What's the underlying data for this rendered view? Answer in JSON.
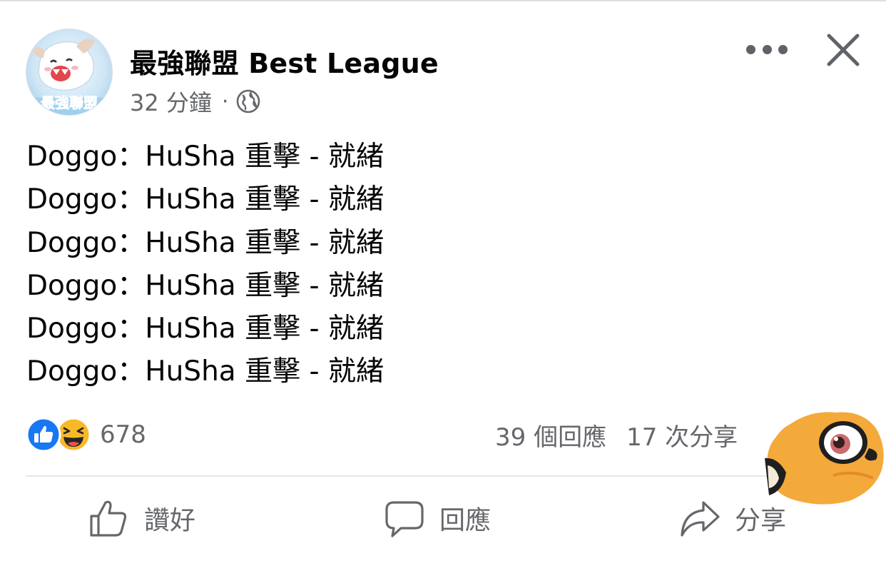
{
  "post": {
    "page_name": "最強聯盟 Best League",
    "timestamp": "32 分鐘",
    "separator": "·",
    "privacy_icon": "globe-icon",
    "avatar_text": "最強聯盟",
    "body_lines": [
      "Doggo：HuSha 重擊 - 就緒",
      "Doggo：HuSha 重擊 - 就緒",
      "Doggo：HuSha 重擊 - 就緒",
      "Doggo：HuSha 重擊 - 就緒",
      "Doggo：HuSha 重擊 - 就緒",
      "Doggo：HuSha 重擊 - 就緒"
    ]
  },
  "stats": {
    "reaction_icons": [
      "like-icon",
      "haha-icon"
    ],
    "reaction_count": "678",
    "comments": "39 個回應",
    "shares": "17 次分享"
  },
  "actions": {
    "like_label": "讚好",
    "comment_label": "回應",
    "share_label": "分享"
  },
  "colors": {
    "like_blue": "#1877f2",
    "haha_yellow": "#f7b928",
    "secondary_text": "#65676b",
    "overlay_orange": "#f4a93b"
  }
}
